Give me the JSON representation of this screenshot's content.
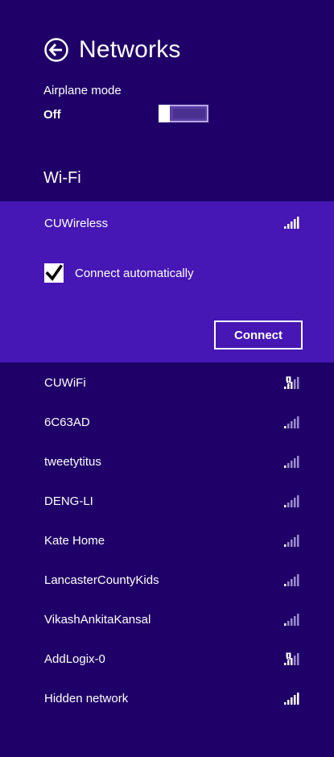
{
  "header": {
    "title": "Networks",
    "back_icon": "back-arrow-circle-icon"
  },
  "airplane_mode": {
    "label": "Airplane mode",
    "state": "Off",
    "on": false
  },
  "wifi": {
    "section_label": "Wi-Fi",
    "selected": {
      "name": "CUWireless",
      "signal": "full",
      "connect_automatically_label": "Connect automatically",
      "connect_automatically": true,
      "connect_button_label": "Connect"
    },
    "networks": [
      {
        "name": "CUWiFi",
        "secured": true,
        "signal_strong": true
      },
      {
        "name": "6C63AD",
        "secured": false,
        "signal_strong": false
      },
      {
        "name": "tweetytitus",
        "secured": false,
        "signal_strong": false
      },
      {
        "name": "DENG-LI",
        "secured": false,
        "signal_strong": false
      },
      {
        "name": "Kate Home",
        "secured": false,
        "signal_strong": false
      },
      {
        "name": "LancasterCountyKids",
        "secured": false,
        "signal_strong": false
      },
      {
        "name": "VikashAnkitaKansal",
        "secured": false,
        "signal_strong": false
      },
      {
        "name": "AddLogix-0",
        "secured": true,
        "signal_strong": true
      },
      {
        "name": "Hidden network",
        "secured": false,
        "signal_strong": true
      }
    ]
  },
  "colors": {
    "background": "#1f0068",
    "selected_background": "#4617b4",
    "text": "#ffffff",
    "weak_signal": "#9a8ccc"
  }
}
